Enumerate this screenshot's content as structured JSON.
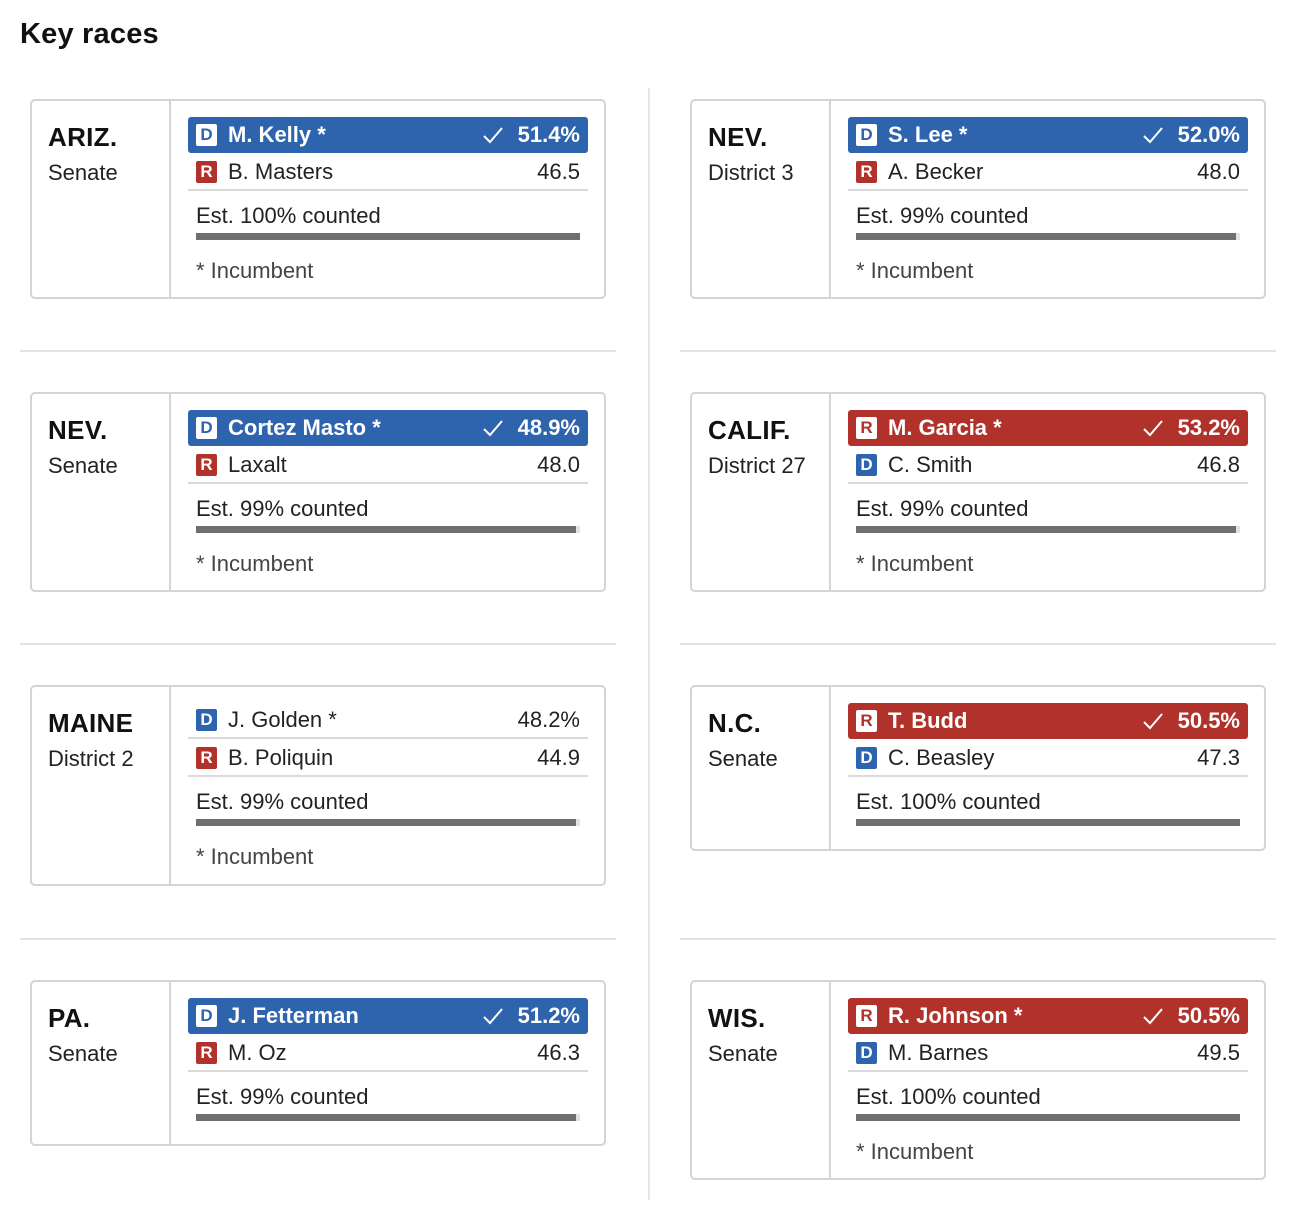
{
  "title": "Key races",
  "colors": {
    "dem": "#2e63ad",
    "rep": "#b1322b",
    "bar": "#6f6f6f",
    "track": "#e2e2e2"
  },
  "races": [
    {
      "state": "ARIZ.",
      "race": "Senate",
      "candidates": [
        {
          "party": "D",
          "name": "M. Kelly *",
          "pct": "51.4%",
          "winner": true
        },
        {
          "party": "R",
          "name": "B. Masters",
          "pct": "46.5",
          "winner": false
        }
      ],
      "counted": "Est. 100% counted",
      "counted_fraction": 1.0,
      "note": "* Incumbent"
    },
    {
      "state": "NEV.",
      "race": "District 3",
      "candidates": [
        {
          "party": "D",
          "name": "S. Lee *",
          "pct": "52.0%",
          "winner": true
        },
        {
          "party": "R",
          "name": "A. Becker",
          "pct": "48.0",
          "winner": false
        }
      ],
      "counted": "Est. 99% counted",
      "counted_fraction": 0.99,
      "note": "* Incumbent"
    },
    {
      "state": "NEV.",
      "race": "Senate",
      "candidates": [
        {
          "party": "D",
          "name": "Cortez Masto *",
          "pct": "48.9%",
          "winner": true
        },
        {
          "party": "R",
          "name": "Laxalt",
          "pct": "48.0",
          "winner": false
        }
      ],
      "counted": "Est. 99% counted",
      "counted_fraction": 0.99,
      "note": "* Incumbent"
    },
    {
      "state": "CALIF.",
      "race": "District 27",
      "candidates": [
        {
          "party": "R",
          "name": "M. Garcia *",
          "pct": "53.2%",
          "winner": true
        },
        {
          "party": "D",
          "name": "C. Smith",
          "pct": "46.8",
          "winner": false
        }
      ],
      "counted": "Est. 99% counted",
      "counted_fraction": 0.99,
      "note": "* Incumbent"
    },
    {
      "state": "MAINE",
      "race": "District 2",
      "candidates": [
        {
          "party": "D",
          "name": "J. Golden *",
          "pct": "48.2%",
          "winner": false
        },
        {
          "party": "R",
          "name": "B. Poliquin",
          "pct": "44.9",
          "winner": false
        }
      ],
      "counted": "Est. 99% counted",
      "counted_fraction": 0.99,
      "note": "* Incumbent"
    },
    {
      "state": "N.C.",
      "race": "Senate",
      "candidates": [
        {
          "party": "R",
          "name": "T. Budd",
          "pct": "50.5%",
          "winner": true
        },
        {
          "party": "D",
          "name": "C. Beasley",
          "pct": "47.3",
          "winner": false
        }
      ],
      "counted": "Est. 100% counted",
      "counted_fraction": 1.0,
      "note": ""
    },
    {
      "state": "PA.",
      "race": "Senate",
      "candidates": [
        {
          "party": "D",
          "name": "J. Fetterman",
          "pct": "51.2%",
          "winner": true
        },
        {
          "party": "R",
          "name": "M. Oz",
          "pct": "46.3",
          "winner": false
        }
      ],
      "counted": "Est. 99% counted",
      "counted_fraction": 0.99,
      "note": ""
    },
    {
      "state": "WIS.",
      "race": "Senate",
      "candidates": [
        {
          "party": "R",
          "name": "R. Johnson *",
          "pct": "50.5%",
          "winner": true
        },
        {
          "party": "D",
          "name": "M. Barnes",
          "pct": "49.5",
          "winner": false
        }
      ],
      "counted": "Est. 100% counted",
      "counted_fraction": 1.0,
      "note": "* Incumbent"
    }
  ]
}
